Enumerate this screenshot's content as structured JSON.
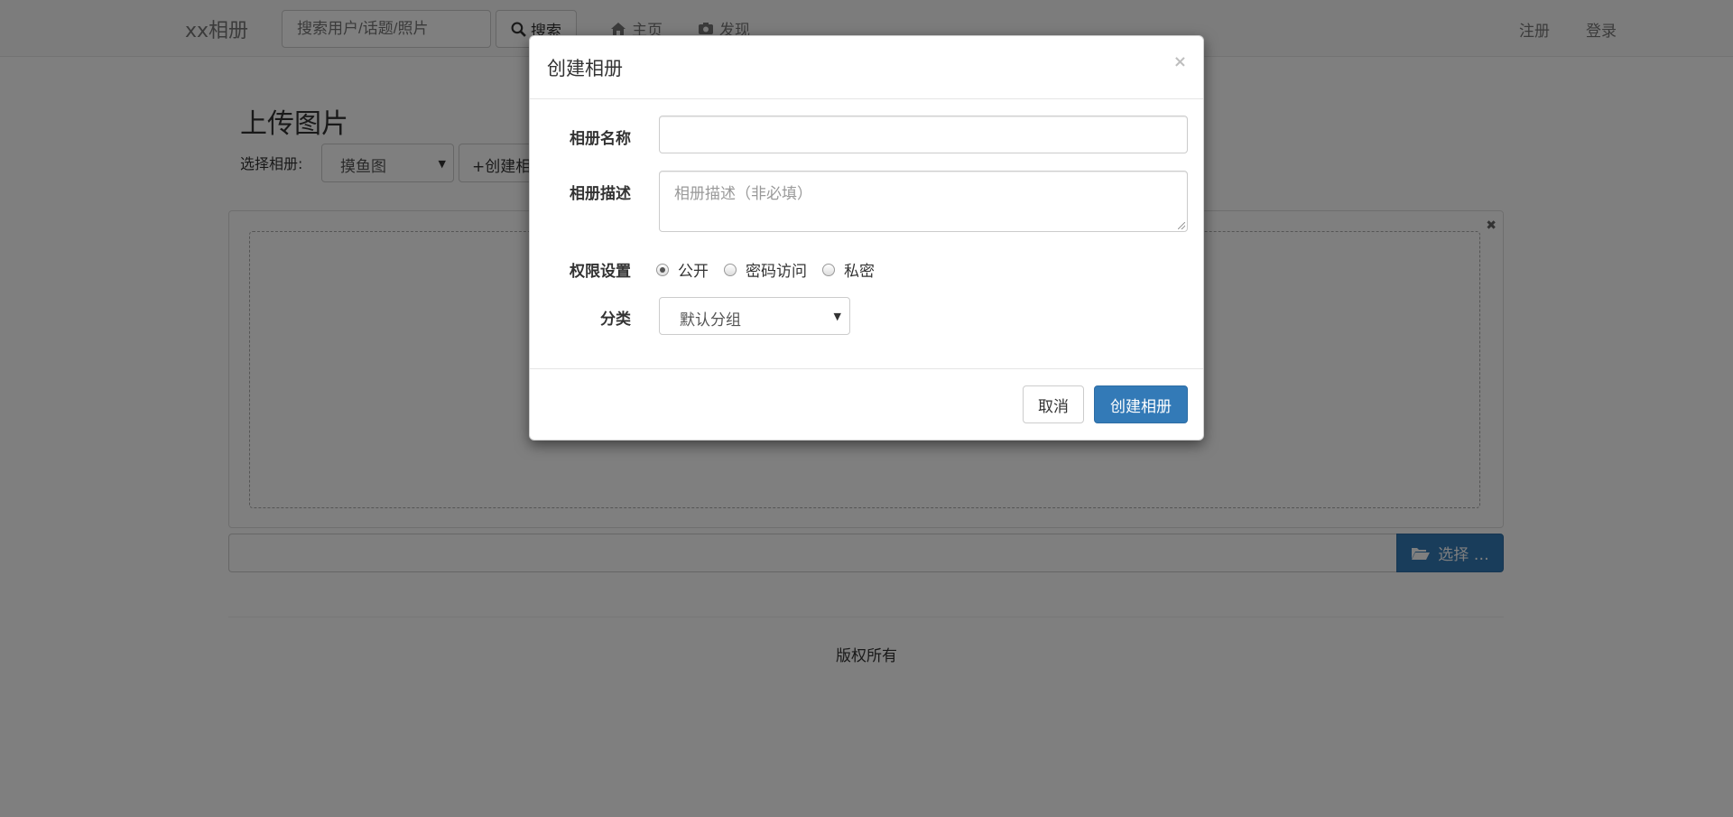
{
  "navbar": {
    "brand": "xx相册",
    "search_placeholder": "搜索用户/话题/照片",
    "search_button": "搜索",
    "links": [
      {
        "label": "主页",
        "icon": "home-icon"
      },
      {
        "label": "发现",
        "icon": "camera-icon"
      }
    ],
    "register": "注册",
    "login": "登录"
  },
  "page": {
    "title": "上传图片",
    "album_label": "选择相册:",
    "album_selected": "摸鱼图",
    "create_album_button": "+创建相册",
    "browse_button": "选择 …",
    "footer": "版权所有"
  },
  "modal": {
    "title": "创建相册",
    "close_glyph": "×",
    "name_label": "相册名称",
    "name_value": "",
    "desc_label": "相册描述",
    "desc_placeholder": "相册描述（非必填）",
    "permission_label": "权限设置",
    "permission_options": [
      "公开",
      "密码访问",
      "私密"
    ],
    "permission_selected": "公开",
    "category_label": "分类",
    "category_selected": "默认分组",
    "cancel_button": "取消",
    "create_button": "创建相册"
  },
  "colors": {
    "primary": "#337ab7",
    "backdrop": "rgba(0,0,0,0.5)"
  }
}
